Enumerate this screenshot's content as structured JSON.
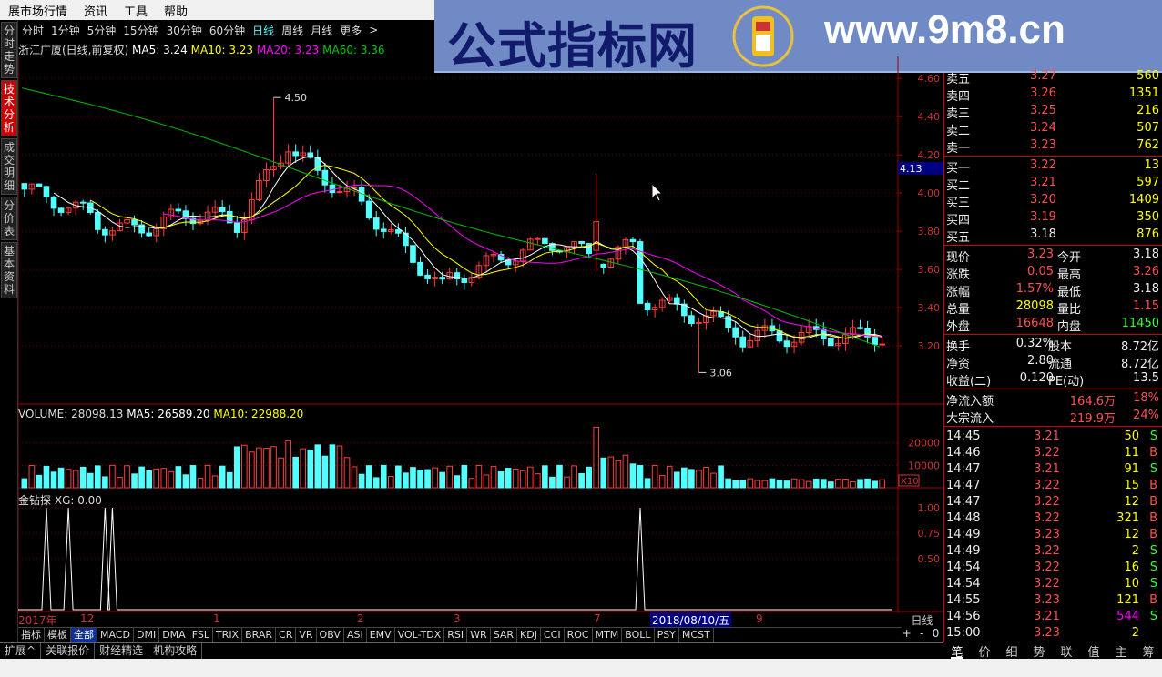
{
  "menu": [
    "展市场行情",
    "资讯",
    "工具",
    "帮助"
  ],
  "banner": {
    "title": "公式指标网",
    "url": "www.9m8.cn",
    "logo_small": "www.9m8.cn"
  },
  "periods": [
    "分时",
    "1分钟",
    "5分钟",
    "15分钟",
    "30分钟",
    "60分钟",
    "日线",
    "周线",
    "月线",
    "更多",
    ">"
  ],
  "active_period": "日线",
  "side_tabs": [
    "分时走势",
    "技术分析",
    "成交明细",
    "分价表",
    "基本资料"
  ],
  "active_side_tab": "技术分析",
  "title": {
    "name": "浙江广厦(日线,前复权)",
    "ma5": "MA5: 3.24",
    "ma10": "MA10: 3.23",
    "ma20": "MA20: 3.23",
    "ma60": "MA60: 3.36"
  },
  "price_axis": [
    "4.60",
    "4.40",
    "4.20",
    "4.00",
    "3.80",
    "3.60",
    "3.40",
    "3.20"
  ],
  "price_marker": "4.13",
  "annotations": {
    "high": "4.50",
    "low": "3.06"
  },
  "volume_title": {
    "vol": "VOLUME: 28098.13",
    "ma5": "MA5: 26589.20",
    "ma10": "MA10: 22988.20"
  },
  "volume_axis": [
    "20000",
    "10000"
  ],
  "volume_unit": "X10",
  "indicator_title": {
    "name": "金钻探",
    "xg": "XG: 0.00"
  },
  "indicator_axis": [
    "1.00",
    "0.75",
    "0.50"
  ],
  "date_labels": [
    "2017年",
    "12",
    "1",
    "2",
    "3",
    "7",
    "2018/08/10/五",
    "9"
  ],
  "day_line": "日线",
  "indicator_tabs": [
    "指标",
    "模板",
    "全部",
    "MACD",
    "DMI",
    "DMA",
    "FSL",
    "TRIX",
    "BRAR",
    "CR",
    "VR",
    "OBV",
    "ASI",
    "EMV",
    "VOL-TDX",
    "RSI",
    "WR",
    "SAR",
    "KDJ",
    "CCI",
    "ROC",
    "MTM",
    "BOLL",
    "PSY",
    "MCST"
  ],
  "active_indicator_tab": "全部",
  "zoom": [
    "+",
    "-",
    "0"
  ],
  "bottom_tabs": [
    "扩展^",
    "关联报价",
    "财经精选",
    "机构攻略"
  ],
  "right_tabs": [
    "笔",
    "价",
    "细",
    "势",
    "联",
    "值",
    "主",
    "筹"
  ],
  "sell": [
    {
      "label": "卖五",
      "price": "3.27",
      "vol": "560"
    },
    {
      "label": "卖四",
      "price": "3.26",
      "vol": "1351"
    },
    {
      "label": "卖三",
      "price": "3.25",
      "vol": "216"
    },
    {
      "label": "卖二",
      "price": "3.24",
      "vol": "507"
    },
    {
      "label": "卖一",
      "price": "3.23",
      "vol": "762"
    }
  ],
  "buy": [
    {
      "label": "买一",
      "price": "3.22",
      "vol": "13"
    },
    {
      "label": "买二",
      "price": "3.21",
      "vol": "597"
    },
    {
      "label": "买三",
      "price": "3.20",
      "vol": "1409"
    },
    {
      "label": "买四",
      "price": "3.19",
      "vol": "350"
    },
    {
      "label": "买五",
      "price": "3.18",
      "vol": "876"
    }
  ],
  "stats": [
    {
      "l1": "现价",
      "v1": "3.23",
      "l2": "今开",
      "v2": "3.18"
    },
    {
      "l1": "涨跌",
      "v1": "0.05",
      "l2": "最高",
      "v2": "3.26"
    },
    {
      "l1": "涨幅",
      "v1": "1.57%",
      "l2": "最低",
      "v2": "3.18"
    },
    {
      "l1": "总量",
      "v1": "28098",
      "l2": "量比",
      "v2": "1.15"
    },
    {
      "l1": "外盘",
      "v1": "16648",
      "l2": "内盘",
      "v2": "11450"
    }
  ],
  "fundamentals": [
    {
      "l1": "换手",
      "v1": "0.32%",
      "l2": "股本",
      "v2": "8.72亿"
    },
    {
      "l1": "净资",
      "v1": "2.80",
      "l2": "流通",
      "v2": "8.72亿"
    },
    {
      "l1": "收益(二)",
      "v1": "0.120",
      "l2": "PE(动)",
      "v2": "13.5"
    }
  ],
  "flows": [
    {
      "label": "净流入额",
      "value": "164.6万",
      "pct": "18%"
    },
    {
      "label": "大宗流入",
      "value": "219.9万",
      "pct": "24%"
    }
  ],
  "ticks": [
    {
      "t": "14:45",
      "p": "3.21",
      "v": "50",
      "s": "S"
    },
    {
      "t": "14:46",
      "p": "3.22",
      "v": "11",
      "s": "B"
    },
    {
      "t": "14:47",
      "p": "3.21",
      "v": "91",
      "s": "S"
    },
    {
      "t": "14:47",
      "p": "3.22",
      "v": "15",
      "s": "B"
    },
    {
      "t": "14:47",
      "p": "3.22",
      "v": "12",
      "s": "B"
    },
    {
      "t": "14:48",
      "p": "3.22",
      "v": "321",
      "s": "B"
    },
    {
      "t": "14:49",
      "p": "3.23",
      "v": "12",
      "s": "B"
    },
    {
      "t": "14:49",
      "p": "3.22",
      "v": "2",
      "s": "S"
    },
    {
      "t": "14:54",
      "p": "3.22",
      "v": "16",
      "s": "S"
    },
    {
      "t": "14:54",
      "p": "3.22",
      "v": "10",
      "s": "S"
    },
    {
      "t": "14:55",
      "p": "3.23",
      "v": "121",
      "s": "B"
    },
    {
      "t": "14:56",
      "p": "3.21",
      "v": "544",
      "s": "S"
    },
    {
      "t": "15:00",
      "p": "3.23",
      "v": "2",
      "s": ""
    }
  ],
  "colors": {
    "up": "#ff3c3c",
    "down": "#54ffff",
    "ma5": "#ffffff",
    "ma10": "#ffff00",
    "ma20": "#ff00ff",
    "ma60": "#00c000",
    "grid": "#a00000"
  }
}
